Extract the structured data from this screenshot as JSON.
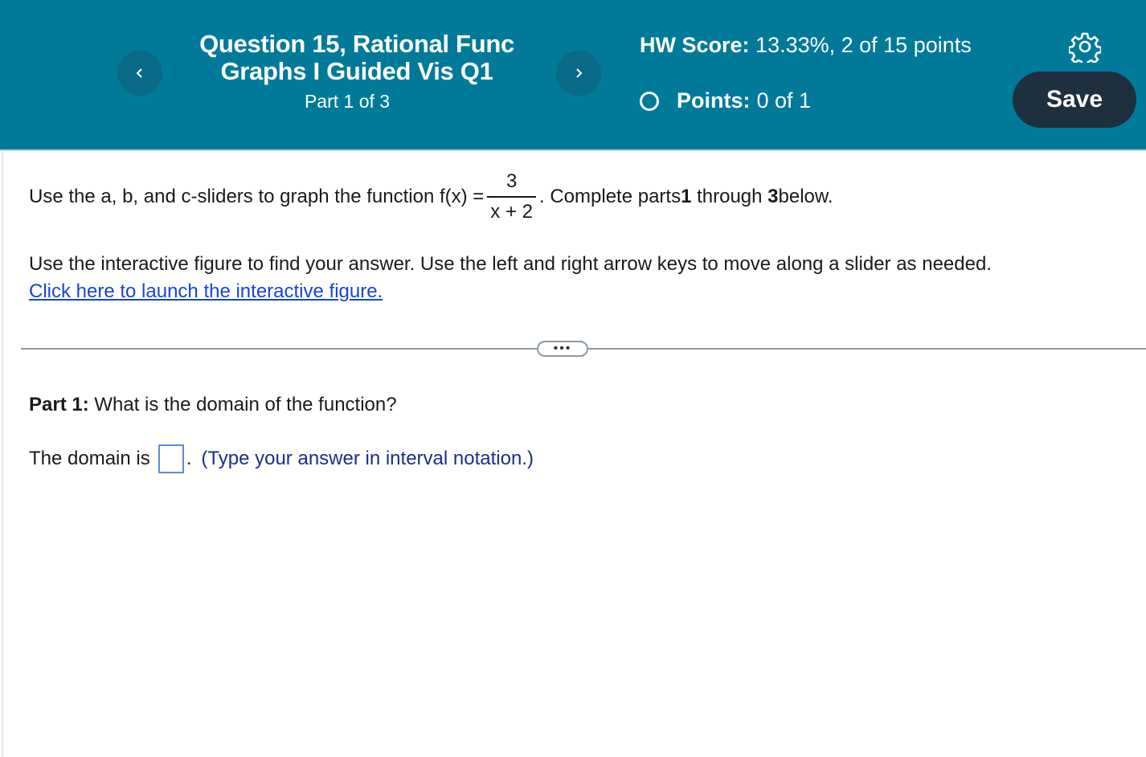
{
  "header": {
    "question_title": "Question 15, Rational Func Graphs I Guided Vis Q1",
    "part_indicator": "Part 1 of 3",
    "hw_score_label": "HW Score:",
    "hw_score_value": "13.33%, 2 of 15 points",
    "points_label": "Points:",
    "points_value": "0 of 1",
    "save_label": "Save",
    "prev_icon": "chevron-left-icon",
    "next_icon": "chevron-right-icon",
    "settings_icon": "gear-icon"
  },
  "question": {
    "stem_before": "Use the a, b, and c-sliders to graph the function f(x) =",
    "fraction_numerator": "3",
    "fraction_denominator": "x + 2",
    "stem_after_prefix": ". Complete parts ",
    "stem_part_start": "1",
    "stem_through": " through ",
    "stem_part_end": "3",
    "stem_below": " below.",
    "instruction": "Use the interactive figure to find your answer. Use the left and right arrow keys to move along a slider as needed.",
    "launch_link": "Click here to launch the interactive figure.",
    "more_label": "•••"
  },
  "part1": {
    "label": "Part 1:",
    "prompt": " What is the domain of the function?",
    "answer_prefix": "The domain is",
    "answer_value": "",
    "answer_suffix": ".",
    "hint": "(Type your answer in interval notation.)"
  },
  "colors": {
    "header_bg": "#017a9a",
    "save_button_bg": "#1e2f3e",
    "link": "#1a44d6",
    "hint_text": "#1a2f8a"
  }
}
